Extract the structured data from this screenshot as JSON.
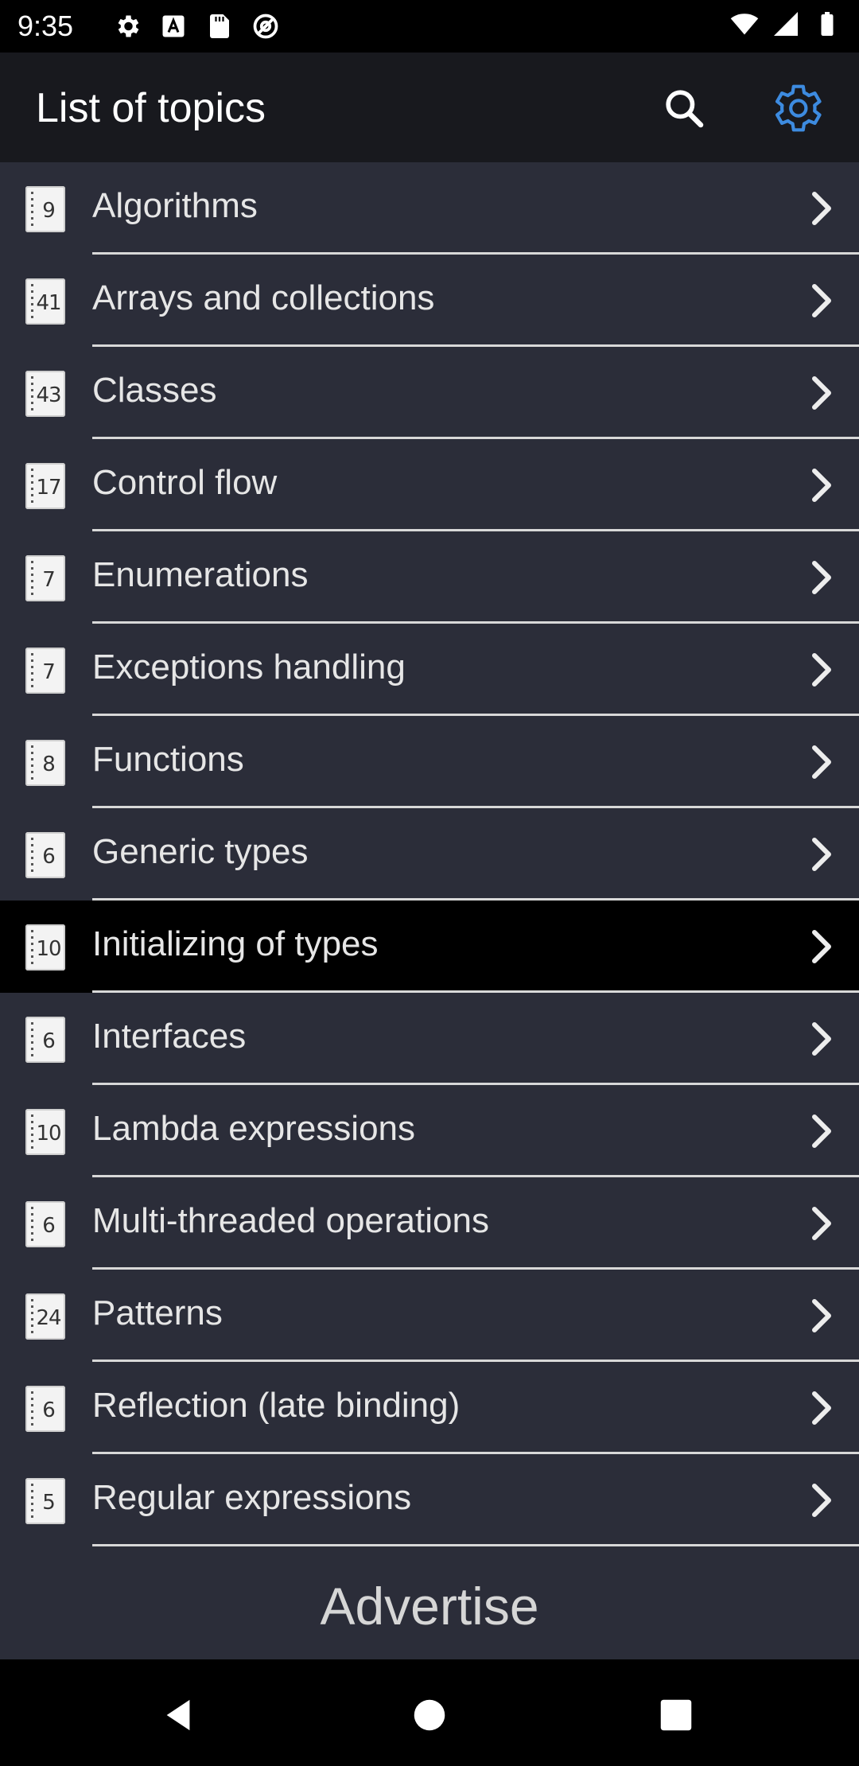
{
  "status_bar": {
    "time": "9:35",
    "left_icons": [
      "settings-icon",
      "a-notification-icon",
      "sd-card-icon",
      "at-sign-icon"
    ],
    "right_icons": [
      "wifi-icon",
      "signal-icon",
      "battery-icon"
    ]
  },
  "app_bar": {
    "title": "List of topics",
    "search_icon": "search-icon",
    "settings_icon": "gear-icon",
    "settings_color": "#3d8be0"
  },
  "topics": [
    {
      "label": "Algorithms",
      "count": "9"
    },
    {
      "label": "Arrays and collections",
      "count": "41"
    },
    {
      "label": "Classes",
      "count": "43"
    },
    {
      "label": "Control flow",
      "count": "17"
    },
    {
      "label": "Enumerations",
      "count": "7"
    },
    {
      "label": "Exceptions handling",
      "count": "7"
    },
    {
      "label": "Functions",
      "count": "8"
    },
    {
      "label": "Generic types",
      "count": "6"
    },
    {
      "label": "Initializing of types",
      "count": "10",
      "selected": true
    },
    {
      "label": "Interfaces",
      "count": "6"
    },
    {
      "label": "Lambda expressions",
      "count": "10"
    },
    {
      "label": "Multi-threaded operations",
      "count": "6"
    },
    {
      "label": "Patterns",
      "count": "24"
    },
    {
      "label": "Reflection (late binding)",
      "count": "6"
    },
    {
      "label": "Regular expressions",
      "count": "5"
    }
  ],
  "advertise": "Advertise",
  "nav_bar": {
    "back_icon": "back-triangle-icon",
    "home_icon": "home-circle-icon",
    "recents_icon": "recents-square-icon"
  },
  "colors": {
    "background": "#2b2d39",
    "app_bar": "#18191e",
    "selected_row": "#000000",
    "divider": "#d8d8d8"
  }
}
